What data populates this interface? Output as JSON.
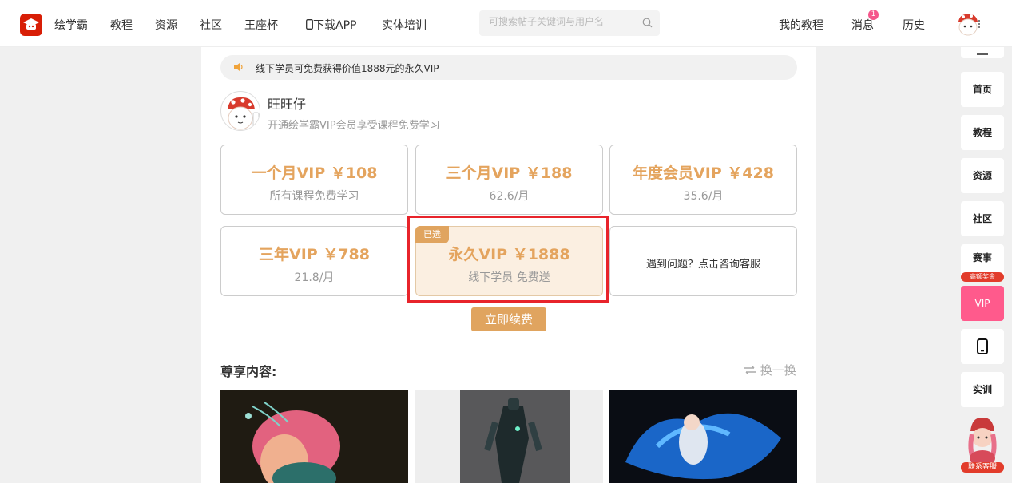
{
  "nav": {
    "items": [
      "绘学霸",
      "教程",
      "资源",
      "社区",
      "王座杯",
      "下载APP",
      "实体培训"
    ],
    "search_placeholder": "可搜索帖子关键词与用户名",
    "right": [
      "我的教程",
      "消息",
      "历史"
    ],
    "message_badge": "1",
    "logo_text": "绘学霸"
  },
  "notice": {
    "text": "线下学员可免费获得价值1888元的永久VIP"
  },
  "user": {
    "name": "旺旺仔",
    "subtitle": "开通绘学霸VIP会员享受课程免费学习"
  },
  "plans": [
    {
      "title": "一个月VIP ￥108",
      "sub": "所有课程免费学习"
    },
    {
      "title": "三个月VIP ￥188",
      "sub": "62.6/月"
    },
    {
      "title": "年度会员VIP ￥428",
      "sub": "35.6/月"
    },
    {
      "title": "三年VIP ￥788",
      "sub": "21.8/月"
    },
    {
      "title": "永久VIP ￥1888",
      "sub": "线下学员 免费送",
      "tag": "已选"
    }
  ],
  "help_text": "遇到问题？点击咨询客服",
  "renew_label": "立即续费",
  "section": {
    "title": "尊享内容:",
    "swap_label": "换一换"
  },
  "sidebar": {
    "items": [
      "首页",
      "教程",
      "资源",
      "社区",
      "赛事",
      "VIP",
      "实训"
    ],
    "contest_tag": "高额奖金",
    "service_label": "联系客服"
  },
  "colors": {
    "accent": "#e0a45f",
    "vip_pink": "#ff5a8c",
    "brand_red": "#d81e06",
    "highlight_red": "#e8242b"
  }
}
